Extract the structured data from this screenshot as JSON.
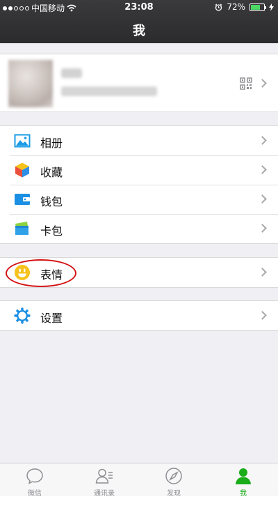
{
  "status_bar": {
    "carrier": "中国移动",
    "time": "23:08",
    "battery_percent_text": "72%",
    "battery_level": 0.72
  },
  "nav": {
    "title": "我"
  },
  "profile": {
    "name": "",
    "wechat_id": "",
    "qr_icon": "qr-code-icon"
  },
  "menu": {
    "album": {
      "label": "相册",
      "icon": "album-icon"
    },
    "favorites": {
      "label": "收藏",
      "icon": "favorites-cube-icon"
    },
    "wallet": {
      "label": "钱包",
      "icon": "wallet-icon"
    },
    "cards": {
      "label": "卡包",
      "icon": "card-pack-icon"
    },
    "emoji": {
      "label": "表情",
      "icon": "smiley-icon",
      "highlight_color": "#d31212"
    },
    "settings": {
      "label": "设置",
      "icon": "gear-icon"
    }
  },
  "tabbar": {
    "tabs": [
      {
        "label": "微信",
        "icon": "chat-bubble-icon",
        "active": false
      },
      {
        "label": "通讯录",
        "icon": "contacts-icon",
        "active": false
      },
      {
        "label": "发现",
        "icon": "compass-icon",
        "active": false
      },
      {
        "label": "我",
        "icon": "person-icon",
        "active": true
      }
    ]
  },
  "colors": {
    "accent": "#1aad19",
    "header_bg": "#2f2f31",
    "page_bg": "#efeff4"
  }
}
